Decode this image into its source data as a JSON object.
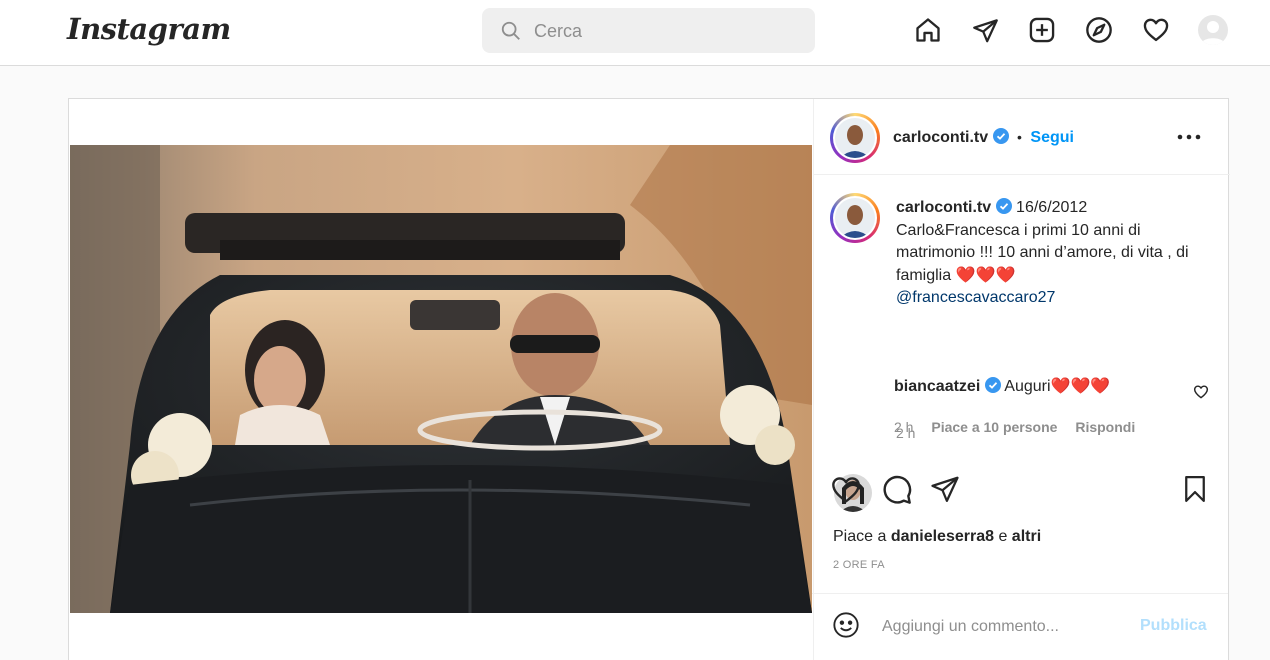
{
  "app": {
    "logo": "Instagram"
  },
  "search": {
    "placeholder": "Cerca"
  },
  "nav": {
    "icons": [
      "home-icon",
      "direct-send-icon",
      "new-post-icon",
      "explore-compass-icon",
      "activity-heart-icon",
      "profile-avatar"
    ]
  },
  "post": {
    "author": "carloconti.tv",
    "follow_label": "Segui",
    "caption": {
      "author": "carloconti.tv",
      "date": "16/6/2012",
      "text": "Carlo&Francesca i primi 10 anni di matrimonio !!! 10 anni d’amore, di vita , di famiglia",
      "hearts": "❤️❤️❤️",
      "mention": "@francescavaccaro27",
      "time": "2 h"
    },
    "comment": {
      "author": "biancaatzei",
      "text": "Auguri",
      "hearts": "❤️❤️❤️",
      "time": "2 h",
      "likes": "Piace a 10 persone",
      "reply": "Rispondi"
    },
    "likes": {
      "prefix": "Piace a ",
      "user": "danieleserra8",
      "middle": " e ",
      "suffix": "altri"
    },
    "timestamp": "2 ORE FA",
    "add_comment_placeholder": "Aggiungi un commento...",
    "publish_label": "Pubblica"
  },
  "colors": {
    "accent": "#0095f6",
    "verified": "#3897f0",
    "publish_disabled": "#b2dffc"
  }
}
